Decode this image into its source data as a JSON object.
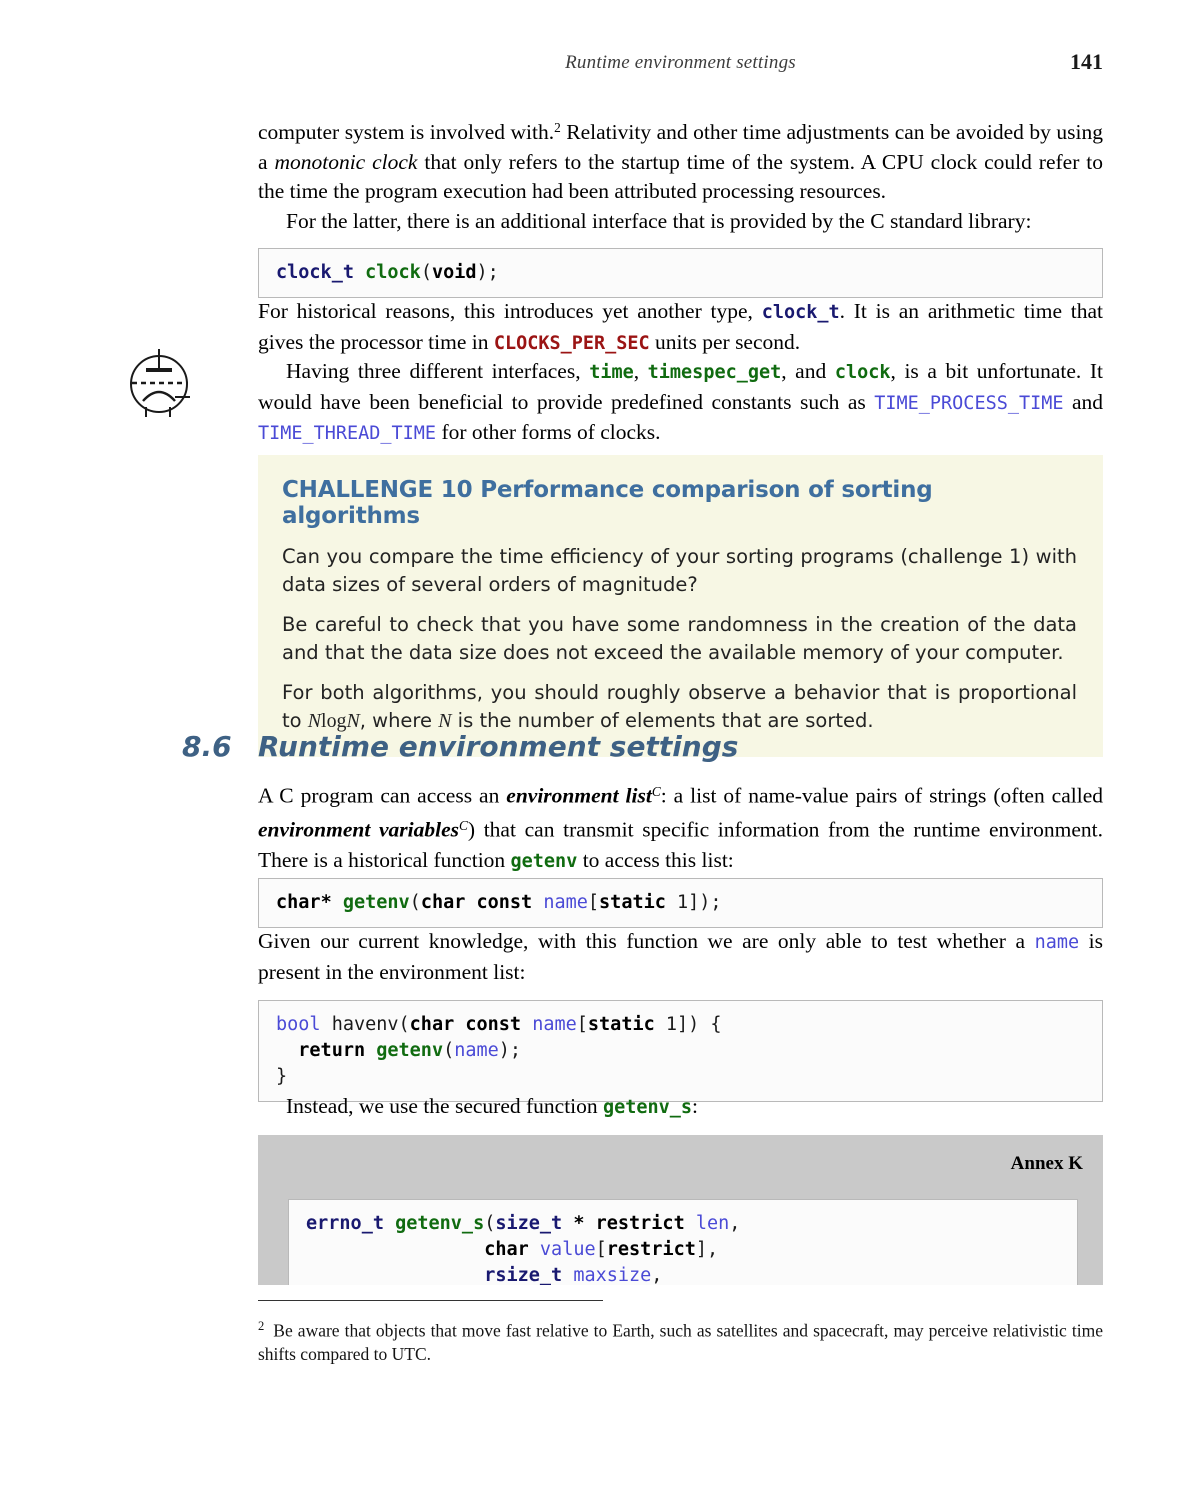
{
  "page": {
    "running_head": "Runtime environment settings",
    "page_number": "141"
  },
  "paragraphs": {
    "p1_a": "computer system is involved with.",
    "p1_fn": "2",
    "p1_b": " Relativity and other time adjustments can be avoided by using a ",
    "p1_em1": "monotonic clock",
    "p1_c": " that only refers to the startup time of the system. A CPU clock could refer to the time the program execution had been attributed processing resources.",
    "p2": "For the latter, there is an additional interface that is provided by the C standard library:",
    "p3_a": "For historical reasons, this introduces yet another type, ",
    "p3_code1": "clock_t",
    "p3_b": ". It is an arithmetic time that gives the processor time in ",
    "p3_code2": "CLOCKS_PER_SEC",
    "p3_c": " units per second.",
    "p4_a": "Having three different interfaces, ",
    "p4_code1": "time",
    "p4_b": ", ",
    "p4_code2": "timespec_get",
    "p4_c": ", and ",
    "p4_code3": "clock",
    "p4_d": ", is a bit unfortunate.   It would have been beneficial to provide predefined constants such as ",
    "p4_code4": "TIME_PROCESS_TIME",
    "p4_e": " and ",
    "p4_code5": "TIME_THREAD_TIME",
    "p4_f": " for other forms of clocks.",
    "p5_a": "A C program can access an ",
    "p5_em1": "environment list",
    "p5_sup1": "C",
    "p5_b": ": a list of name-value pairs of strings (often called ",
    "p5_em2": "environment variables",
    "p5_sup2": "C",
    "p5_c": ") that can transmit specific information from the runtime environment. There is a historical function ",
    "p5_code1": "getenv",
    "p5_d": " to access this list:",
    "p6_a": "Given our current knowledge, with this function we are only able to test whether a ",
    "p6_code1": "name",
    "p6_b": " is present in the environment list:",
    "p7_a": "Instead, we use the secured function ",
    "p7_code1": "getenv_s",
    "p7_b": ":"
  },
  "code_blocks": {
    "clock_decl": {
      "tokens": [
        {
          "t": "clock_t",
          "c": "navy"
        },
        {
          "t": " ",
          "c": "plain"
        },
        {
          "t": "clock",
          "c": "green"
        },
        {
          "t": "(",
          "c": "plain"
        },
        {
          "t": "void",
          "c": "black"
        },
        {
          "t": ");",
          "c": "plain"
        }
      ]
    },
    "getenv_decl": {
      "tokens": [
        {
          "t": "char",
          "c": "black"
        },
        {
          "t": "*",
          "c": "black"
        },
        {
          "t": " ",
          "c": "plain"
        },
        {
          "t": "getenv",
          "c": "green"
        },
        {
          "t": "(",
          "c": "plain"
        },
        {
          "t": "char const",
          "c": "black"
        },
        {
          "t": " ",
          "c": "plain"
        },
        {
          "t": "name",
          "c": "peri"
        },
        {
          "t": "[",
          "c": "plain"
        },
        {
          "t": "static",
          "c": "black"
        },
        {
          "t": " ",
          "c": "plain"
        },
        {
          "t": "1",
          "c": "plain"
        },
        {
          "t": "]);",
          "c": "plain"
        }
      ]
    },
    "havenv_def": {
      "lines": [
        [
          {
            "t": "bool",
            "c": "peri"
          },
          {
            "t": " havenv(",
            "c": "plain"
          },
          {
            "t": "char const",
            "c": "black"
          },
          {
            "t": " ",
            "c": "plain"
          },
          {
            "t": "name",
            "c": "peri"
          },
          {
            "t": "[",
            "c": "plain"
          },
          {
            "t": "static",
            "c": "black"
          },
          {
            "t": " 1]) {",
            "c": "plain"
          }
        ],
        [
          {
            "t": "  ",
            "c": "plain"
          },
          {
            "t": "return",
            "c": "black"
          },
          {
            "t": " ",
            "c": "plain"
          },
          {
            "t": "getenv",
            "c": "green"
          },
          {
            "t": "(",
            "c": "plain"
          },
          {
            "t": "name",
            "c": "peri"
          },
          {
            "t": ");",
            "c": "plain"
          }
        ],
        [
          {
            "t": "}",
            "c": "plain"
          }
        ]
      ]
    },
    "getenv_s_decl": {
      "lines": [
        [
          {
            "t": "errno_t",
            "c": "navy"
          },
          {
            "t": " ",
            "c": "plain"
          },
          {
            "t": "getenv_s",
            "c": "green"
          },
          {
            "t": "(",
            "c": "plain"
          },
          {
            "t": "size_t",
            "c": "navy"
          },
          {
            "t": " * ",
            "c": "black"
          },
          {
            "t": "restrict",
            "c": "black"
          },
          {
            "t": " ",
            "c": "plain"
          },
          {
            "t": "len",
            "c": "peri"
          },
          {
            "t": ",",
            "c": "plain"
          }
        ],
        [
          {
            "t": "                ",
            "c": "plain"
          },
          {
            "t": "char",
            "c": "black"
          },
          {
            "t": " ",
            "c": "plain"
          },
          {
            "t": "value",
            "c": "peri"
          },
          {
            "t": "[",
            "c": "plain"
          },
          {
            "t": "restrict",
            "c": "black"
          },
          {
            "t": "],",
            "c": "plain"
          }
        ],
        [
          {
            "t": "                ",
            "c": "plain"
          },
          {
            "t": "rsize_t",
            "c": "navy"
          },
          {
            "t": " ",
            "c": "plain"
          },
          {
            "t": "maxsize",
            "c": "peri"
          },
          {
            "t": ",",
            "c": "plain"
          }
        ]
      ]
    }
  },
  "challenge": {
    "heading": "CHALLENGE 10 Performance comparison of sorting algorithms",
    "para1": "Can you compare the time efficiency of your sorting programs (challenge 1) with data sizes of several orders of magnitude?",
    "para2": "Be careful to check that you have some randomness in the creation of the data and that the data size does not exceed the available memory of your computer.",
    "para3_a": "For both algorithms, you should roughly observe a behavior that is proportional to ",
    "para3_math_n1": "N",
    "para3_math_log": "log",
    "para3_math_n2": "N",
    "para3_b": ", where ",
    "para3_math_n3": "N",
    "para3_c": " is the number of elements that are sorted."
  },
  "section": {
    "number": "8.6",
    "title": "Runtime environment settings"
  },
  "annex": {
    "label": "Annex K"
  },
  "footnote": {
    "marker": "2",
    "text": "Be aware that objects that move fast relative to Earth, such as satellites and spacecraft, may perceive relativistic time shifts compared to UTC."
  },
  "icons": {
    "margin_marker": "vacuum-tube-icon"
  },
  "colors": {
    "heading_blue": "#3f6f9f",
    "section_blue": "#3e6184",
    "challenge_bg": "#f7f7e4",
    "annex_bg": "#c9c9c9",
    "code_type_navy": "#191970",
    "code_func_green": "#106b10",
    "code_macro_red": "#9b1414",
    "code_ident_periwinkle": "#4a4ad6"
  }
}
